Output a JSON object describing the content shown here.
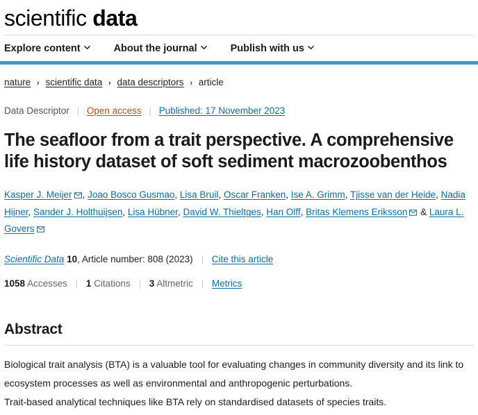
{
  "masthead": {
    "logo_light": "scientific",
    "logo_bold": "data"
  },
  "nav": {
    "items": [
      {
        "label": "Explore content",
        "icon": "chevron-down-icon"
      },
      {
        "label": "About the journal",
        "icon": "chevron-down-icon"
      },
      {
        "label": "Publish with us",
        "icon": "chevron-down-icon"
      }
    ],
    "accent_color": "#3a9bc5"
  },
  "breadcrumb": {
    "items": [
      {
        "label": "nature",
        "current": false
      },
      {
        "label": "scientific data",
        "current": false
      },
      {
        "label": "data descriptors",
        "current": false
      },
      {
        "label": "article",
        "current": true
      }
    ],
    "separator": "›"
  },
  "meta": {
    "type": "Data Descriptor",
    "access": "Open access",
    "access_color": "#b8501b",
    "published": "Published: 17 November 2023",
    "published_color": "#0b6ca8"
  },
  "article": {
    "title": "The seafloor from a trait perspective. A comprehensive life history dataset of soft sediment macrozoobenthos"
  },
  "authors": {
    "list": [
      {
        "name": "Kasper J. Meijer",
        "corresponding": true
      },
      {
        "name": "Joao Bosco Gusmao",
        "corresponding": false
      },
      {
        "name": "Lisa Bruil",
        "corresponding": false
      },
      {
        "name": "Oscar Franken",
        "corresponding": false
      },
      {
        "name": "Ise A. Grimm",
        "corresponding": false
      },
      {
        "name": "Tjisse van der Heide",
        "corresponding": false
      },
      {
        "name": "Nadia Hijner",
        "corresponding": false
      },
      {
        "name": "Sander J. Holthuijsen",
        "corresponding": false
      },
      {
        "name": "Lisa Hübner",
        "corresponding": false
      },
      {
        "name": "David W. Thieltges",
        "corresponding": false
      },
      {
        "name": "Han Olff",
        "corresponding": false
      },
      {
        "name": "Britas Klemens Eriksson",
        "corresponding": true
      },
      {
        "name": "Laura L. Govers",
        "corresponding": true
      }
    ],
    "separator": ", ",
    "last_separator": " & ",
    "mail_icon": "envelope-icon"
  },
  "citation": {
    "journal": "Scientific Data",
    "volume": "10",
    "rest": ", Article number: 808 (2023)",
    "cite_link": "Cite this article"
  },
  "metrics": {
    "accesses_count": "1058",
    "accesses_label": "Accesses",
    "citations_count": "1",
    "citations_label": "Citations",
    "altmetric_count": "3",
    "altmetric_label": "Altmetric",
    "metrics_link": "Metrics"
  },
  "abstract": {
    "heading": "Abstract",
    "paragraph_1": "Biological trait analysis (BTA) is a valuable tool for evaluating changes in community diversity and its link to ecosystem processes as well as environmental and anthropogenic perturbations.",
    "paragraph_2": "Trait-based analytical techniques like BTA rely on standardised datasets of species traits."
  }
}
